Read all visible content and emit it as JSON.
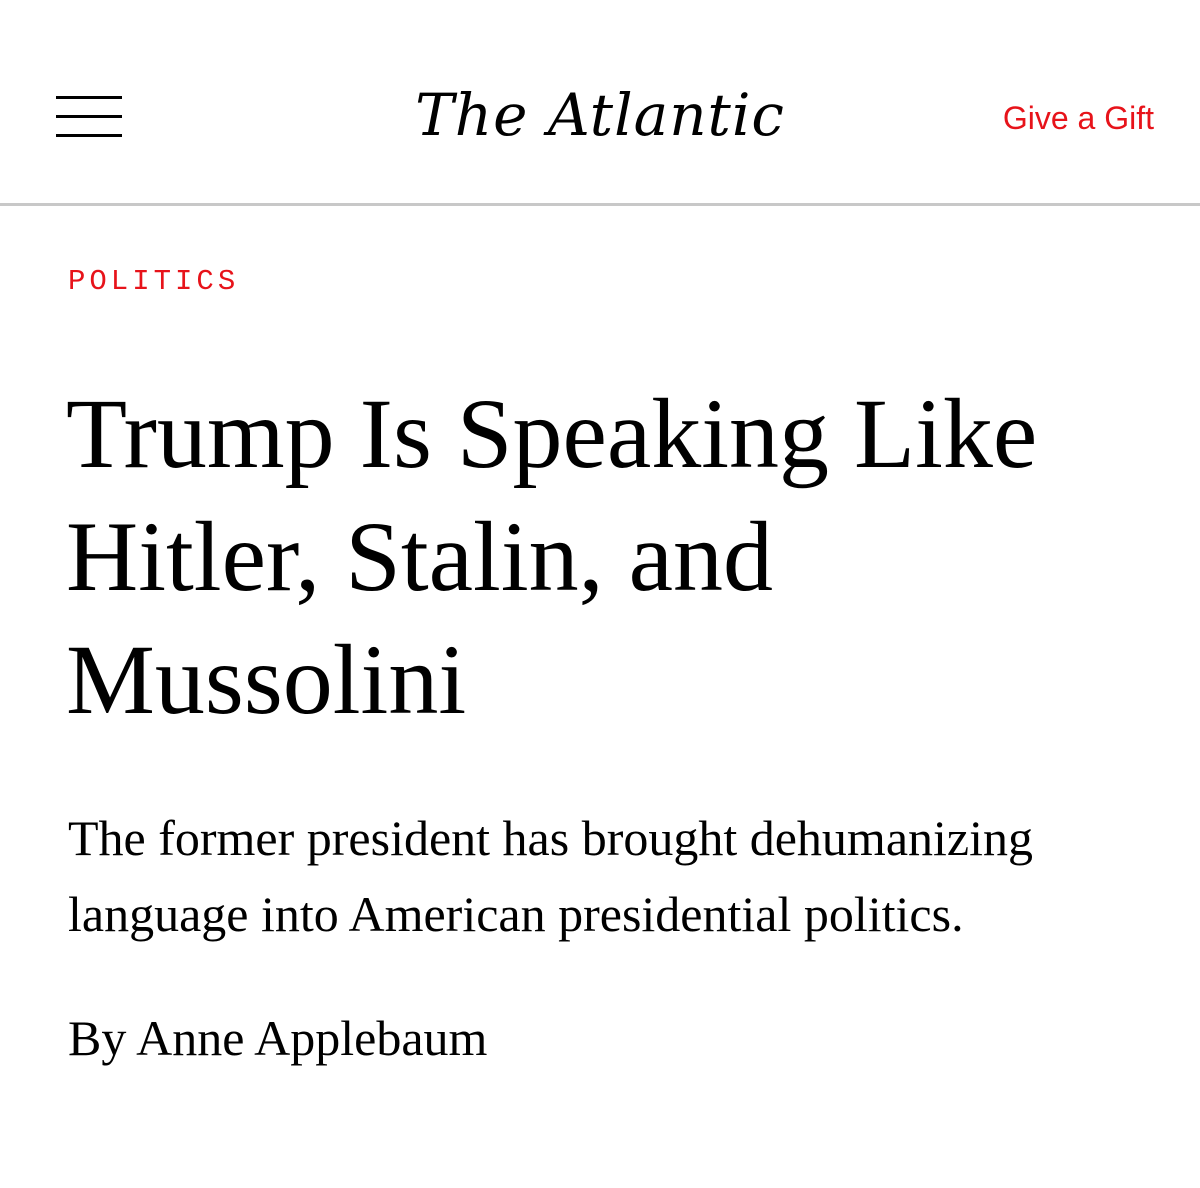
{
  "header": {
    "logo": "The Atlantic",
    "gift_link": "Give a Gift",
    "menu_icon": "hamburger-menu-icon"
  },
  "article": {
    "section": "POLITICS",
    "headline": "Trump Is Speaking Like Hitler, Stalin, and Mussolini",
    "dek": "The former president has brought dehumanizing language into American presidential politics.",
    "byline": "By Anne Applebaum"
  },
  "colors": {
    "accent": "#e7131a",
    "text": "#000000",
    "divider": "#c8c8c8"
  }
}
